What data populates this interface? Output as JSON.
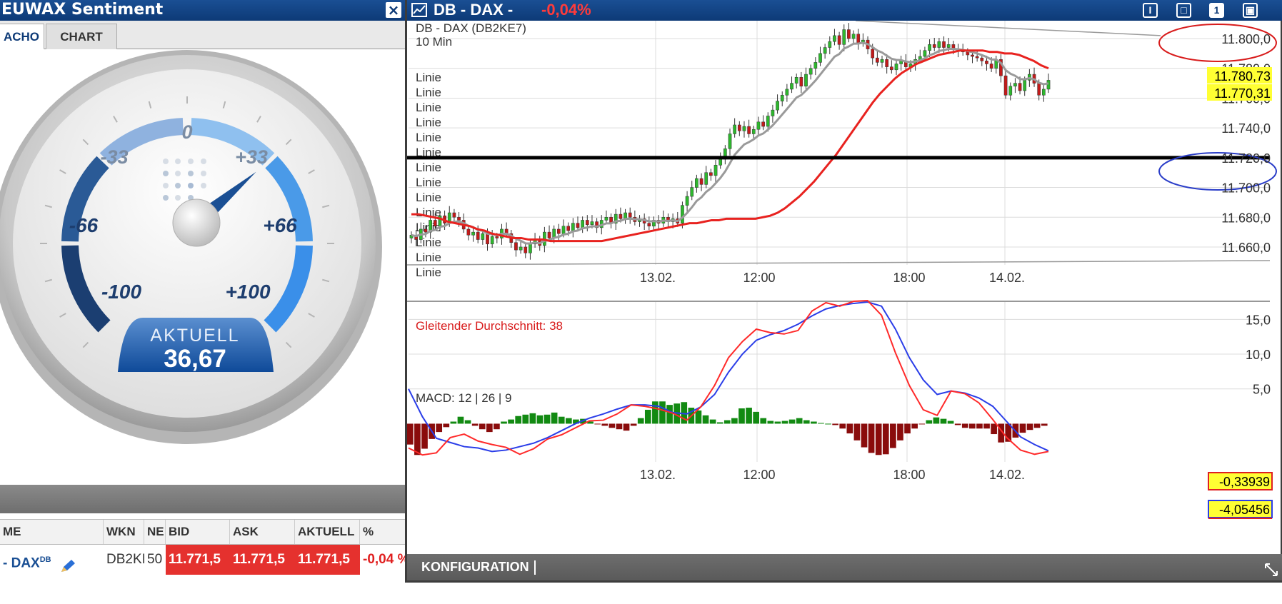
{
  "sentiment": {
    "title": "EUWAX Sentiment",
    "close_label": "×",
    "tabs": [
      {
        "label": "ACHO"
      },
      {
        "label": "CHART"
      }
    ],
    "gauge": {
      "labels": [
        "0",
        "-33",
        "+33",
        "-66",
        "+66",
        "-100",
        "+100"
      ],
      "value": 36.67,
      "current_caption": "AKTUELL",
      "current_value": "36,67"
    },
    "table": {
      "headers": [
        "ME",
        "WKN",
        "NE",
        "BID",
        "ASK",
        "AKTUELL",
        "%"
      ],
      "row": {
        "name": "- DAX",
        "name_sup": "DB",
        "wkn": "DB2KI",
        "ne": "50",
        "bid": "11.771,5",
        "ask": "11.771,5",
        "aktuell": "11.771,5",
        "pct": "-0,04 %"
      }
    }
  },
  "chart_window": {
    "title": "DB - DAX -",
    "change": "-0,04%",
    "buttons": [
      "I",
      "□",
      "1",
      "▣"
    ],
    "footer_label": "KONFIGURATION",
    "colors": {
      "up": "#2db82d",
      "down": "#c21a1a",
      "sma": "#e8221f",
      "ma_grey": "#9a9a9a",
      "macd_line": "#ff2a2a",
      "signal_line": "#2a3de8",
      "hist_pos": "#128a12",
      "hist_neg": "#8a0c0c"
    }
  },
  "chart_data": [
    {
      "type": "candlestick",
      "title": "DB - DAX (DB2KE7)",
      "subtitle": "10 Min",
      "legend": [
        "Linie",
        "Linie",
        "Linie",
        "Linie",
        "Linie",
        "Linie",
        "Linie",
        "Linie",
        "Linie",
        "Linie",
        "Linie",
        "Linie",
        "Linie",
        "Linie"
      ],
      "legend_sma": "Gleitender Durchschnitt: 38",
      "x_ticks": [
        "13.02.",
        "12:00",
        "18:00",
        "14.02."
      ],
      "y_ticks": [
        "11.800,0",
        "11.780,0",
        "11.760,0",
        "11.740,0",
        "11.720,0",
        "11.700,0",
        "11.680,0",
        "11.660,0"
      ],
      "ylim": [
        11648,
        11812
      ],
      "price_labels": [
        "11.780,73",
        "11.770,31"
      ],
      "hline": 11720,
      "trendline": [
        [
          0,
          11812
        ],
        [
          1,
          11802
        ]
      ],
      "close": [
        11668,
        11665,
        11672,
        11670,
        11678,
        11674,
        11681,
        11676,
        11683,
        11680,
        11678,
        11672,
        11668,
        11670,
        11665,
        11669,
        11662,
        11667,
        11666,
        11672,
        11669,
        11663,
        11658,
        11660,
        11656,
        11662,
        11665,
        11661,
        11670,
        11666,
        11672,
        11669,
        11674,
        11671,
        11676,
        11673,
        11678,
        11675,
        11677,
        11673,
        11678,
        11680,
        11676,
        11682,
        11679,
        11683,
        11680,
        11677,
        11679,
        11676,
        11674,
        11678,
        11676,
        11680,
        11677,
        11679,
        11676,
        11688,
        11694,
        11700,
        11706,
        11702,
        11710,
        11708,
        11715,
        11719,
        11726,
        11736,
        11742,
        11738,
        11741,
        11736,
        11739,
        11744,
        11741,
        11748,
        11752,
        11758,
        11762,
        11766,
        11770,
        11774,
        11768,
        11776,
        11780,
        11784,
        11790,
        11794,
        11798,
        11802,
        11796,
        11806,
        11800,
        11803,
        11797,
        11799,
        11793,
        11787,
        11784,
        11786,
        11781,
        11779,
        11783,
        11785,
        11781,
        11783,
        11786,
        11788,
        11792,
        11796,
        11794,
        11798,
        11794,
        11796,
        11793,
        11792,
        11791,
        11789,
        11788,
        11787,
        11785,
        11783,
        11780,
        11786,
        11775,
        11762,
        11768,
        11770,
        11765,
        11772,
        11776,
        11770,
        11762,
        11766,
        11772
      ],
      "sma38": [
        11682,
        11682,
        11681,
        11680,
        11679,
        11677,
        11676,
        11675,
        11674,
        11672,
        11671,
        11669,
        11668,
        11667,
        11666,
        11666,
        11665,
        11665,
        11665,
        11664,
        11664,
        11664,
        11664,
        11664,
        11664,
        11664,
        11664,
        11665,
        11666,
        11667,
        11668,
        11669,
        11670,
        11671,
        11672,
        11673,
        11674,
        11675,
        11676,
        11676,
        11677,
        11678,
        11678,
        11679,
        11679,
        11679,
        11679,
        11679,
        11680,
        11681,
        11683,
        11686,
        11690,
        11694,
        11699,
        11704,
        11710,
        11716,
        11722,
        11729,
        11736,
        11743,
        11750,
        11757,
        11763,
        11768,
        11773,
        11777,
        11780,
        11783,
        11785,
        11787,
        11789,
        11790,
        11791,
        11792,
        11792,
        11792,
        11792,
        11791,
        11791,
        11790,
        11790,
        11789,
        11787,
        11785,
        11782,
        11780
      ]
    },
    {
      "type": "macd",
      "title": "MACD: 12 | 26 | 9",
      "x_ticks": [
        "13.02.",
        "12:00",
        "18:00",
        "14.02."
      ],
      "y_ticks": [
        "15,0",
        "10,0",
        "5,0"
      ],
      "ylim": [
        -5.5,
        17.5
      ],
      "value_labels": [
        "-0,33939",
        "-4,05456"
      ],
      "macd": [
        -3.5,
        -4.5,
        -4.2,
        -2.0,
        -1.5,
        -2.5,
        -3.0,
        -3.4,
        -4.4,
        -3.6,
        -2.2,
        -1.6,
        -0.6,
        0.4,
        0.5,
        1.4,
        2.7,
        2.5,
        2.1,
        1.5,
        0.5,
        2.4,
        5.5,
        9.5,
        11.8,
        13.6,
        13.1,
        12.9,
        13.4,
        16.2,
        17.4,
        16.9,
        17.6,
        17.7,
        15.6,
        10.2,
        5.5,
        2.0,
        1.2,
        4.7,
        4.3,
        3.0,
        0.6,
        -2.0,
        -3.8,
        -4.4,
        -4.0
      ],
      "signal": [
        5.0,
        1.0,
        -2.1,
        -2.7,
        -3.3,
        -3.5,
        -4.0,
        -3.8,
        -3.3,
        -2.8,
        -2.0,
        -1.0,
        0.0,
        0.8,
        1.4,
        2.1,
        2.7,
        2.7,
        2.5,
        1.6,
        1.4,
        2.4,
        4.2,
        7.4,
        10.0,
        12.0,
        12.8,
        13.4,
        14.3,
        15.5,
        16.5,
        17.0,
        17.3,
        17.5,
        16.9,
        13.6,
        9.5,
        6.3,
        4.2,
        4.7,
        4.4,
        3.7,
        2.5,
        0.3,
        -1.9,
        -3.0,
        -3.9
      ],
      "histogram": [
        -3.0,
        -4.5,
        -3.6,
        -2.2,
        -1.2,
        -0.5,
        0.3,
        1.0,
        0.5,
        -0.3,
        -0.8,
        -1.2,
        -0.8,
        0.3,
        0.6,
        1.1,
        1.3,
        1.5,
        1.2,
        1.3,
        1.6,
        1.0,
        0.8,
        0.6,
        0.7,
        0.3,
        -0.1,
        -0.3,
        -0.6,
        -0.8,
        -1.0,
        -0.3,
        0.8,
        2.0,
        3.2,
        3.2,
        2.7,
        2.9,
        3.1,
        2.3,
        1.9,
        1.2,
        0.6,
        0.2,
        0.5,
        0.8,
        2.2,
        2.3,
        1.7,
        0.8,
        0.4,
        0.3,
        0.4,
        0.6,
        0.8,
        0.5,
        0.3,
        0.1,
        0.0,
        -0.2,
        -0.7,
        -1.4,
        -2.4,
        -3.4,
        -4.2,
        -4.5,
        -4.4,
        -3.5,
        -2.4,
        -1.4,
        -0.7,
        -0.1,
        0.5,
        0.9,
        0.7,
        0.4,
        -0.2,
        -0.6,
        -0.7,
        -0.7,
        -0.7,
        -1.5,
        -2.7,
        -2.6,
        -2.0,
        -1.3,
        -0.9,
        -0.6,
        -0.3
      ]
    }
  ]
}
